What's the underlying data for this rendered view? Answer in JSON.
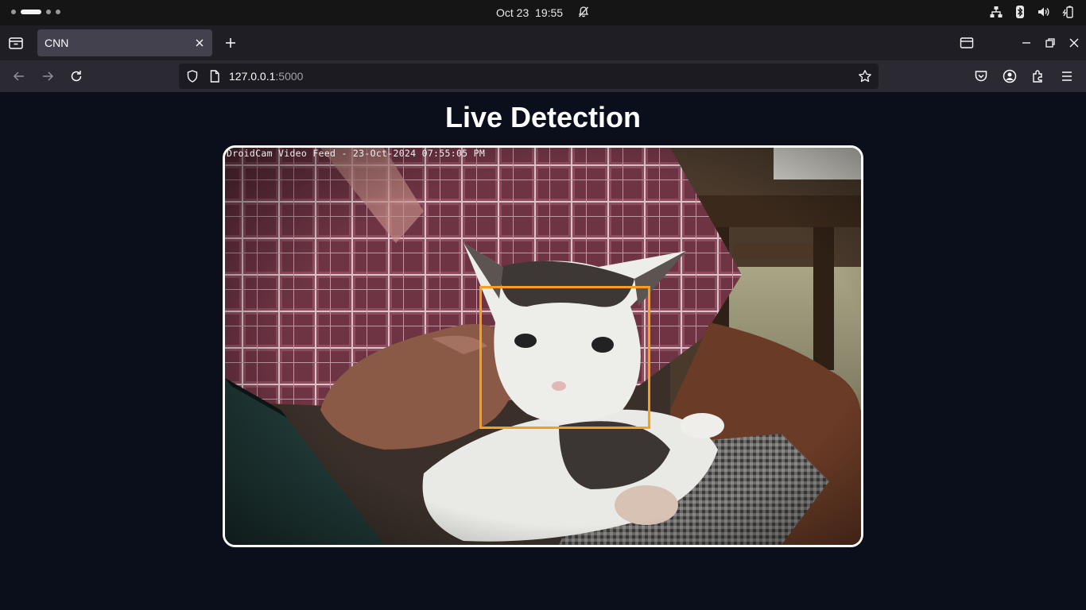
{
  "system_bar": {
    "date": "Oct 23",
    "time": "19:55",
    "icons": [
      "network-icon",
      "bluetooth-icon",
      "volume-icon",
      "battery-icon"
    ]
  },
  "browser": {
    "tab": {
      "title": "CNN"
    },
    "address": {
      "host": "127.0.0.1",
      "port": ":5000"
    }
  },
  "page": {
    "heading": "Live Detection",
    "feed": {
      "overlay_text": "DroidCam Video Feed - 23-Oct-2024 07:55:05 PM",
      "bbox_color": "#f5a015"
    }
  },
  "colors": {
    "page_background": "#0b0f1c",
    "feed_border": "#ffffff"
  }
}
